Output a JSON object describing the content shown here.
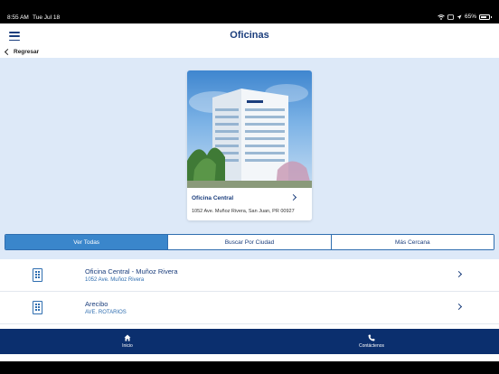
{
  "status_bar": {
    "time": "8:55 AM",
    "date": "Tue Jul 18",
    "battery": "65%"
  },
  "header": {
    "title": "Oficinas",
    "back_label": "Regresar"
  },
  "featured": {
    "title": "Oficina Central",
    "address": "1052 Ave. Muñoz Rivera, San Juan, PR 00927"
  },
  "tabs": [
    {
      "label": "Ver Todas",
      "active": true
    },
    {
      "label": "Buscar Por Ciudad",
      "active": false
    },
    {
      "label": "Más Cercana",
      "active": false
    }
  ],
  "offices": [
    {
      "name": "Oficina Central - Muñoz Rivera",
      "address": "1052 Ave. Muñoz Rivera"
    },
    {
      "name": "Arecibo",
      "address": "AVE. ROTARIOS"
    }
  ],
  "tabbar": {
    "home_label": "Inicio",
    "contact_label": "Contáctenos"
  },
  "colors": {
    "brand": "#1a3d7c",
    "accent": "#3a86cb",
    "tabbar": "#0b2f6e",
    "background": "#dde9f8"
  }
}
